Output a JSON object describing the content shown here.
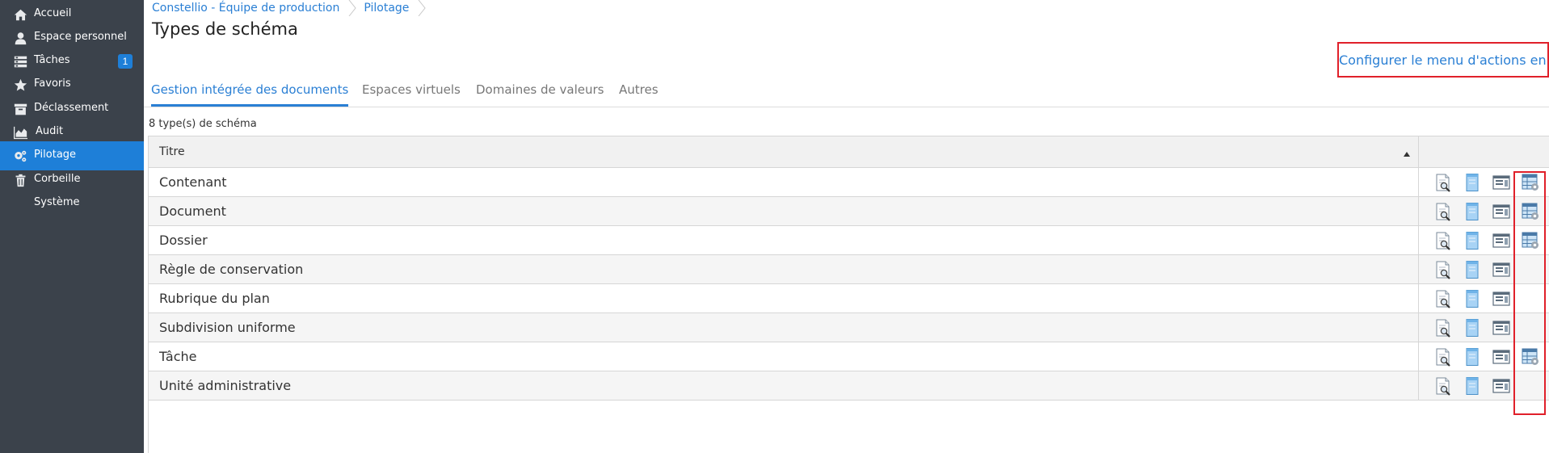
{
  "sidebar": {
    "items": [
      {
        "label": "Accueil",
        "icon": "home-icon",
        "active": false
      },
      {
        "label": "Espace personnel",
        "icon": "user-icon",
        "active": false
      },
      {
        "label": "Tâches",
        "icon": "tasks-icon",
        "active": false,
        "badge": "1"
      },
      {
        "label": "Favoris",
        "icon": "star-icon",
        "active": false
      },
      {
        "label": "Déclassement",
        "icon": "archive-icon",
        "active": false
      },
      {
        "label": "Audit",
        "icon": "chart-area-icon",
        "active": false
      },
      {
        "label": "Pilotage",
        "icon": "gears-icon",
        "active": true
      },
      {
        "label": "Corbeille",
        "icon": "trash-icon",
        "active": false
      },
      {
        "label": "Système",
        "icon": "",
        "active": false
      }
    ]
  },
  "breadcrumb": {
    "items": [
      "Constellio - Équipe de production",
      "Pilotage"
    ]
  },
  "page": {
    "title": "Types de schéma",
    "batch_link": "Configurer le menu d'actions en lot",
    "count_label": "8 type(s) de schéma"
  },
  "tabs": [
    {
      "label": "Gestion intégrée des documents",
      "active": true
    },
    {
      "label": "Espaces virtuels",
      "active": false
    },
    {
      "label": "Domaines de valeurs",
      "active": false
    },
    {
      "label": "Autres",
      "active": false
    }
  ],
  "table": {
    "header_title": "Titre",
    "rows": [
      {
        "title": "Contenant",
        "batch_action": true
      },
      {
        "title": "Document",
        "batch_action": true
      },
      {
        "title": "Dossier",
        "batch_action": true
      },
      {
        "title": "Règle de conservation",
        "batch_action": false
      },
      {
        "title": "Rubrique du plan",
        "batch_action": false
      },
      {
        "title": "Subdivision uniforme",
        "batch_action": false
      },
      {
        "title": "Tâche",
        "batch_action": true
      },
      {
        "title": "Unité administrative",
        "batch_action": false
      }
    ]
  },
  "colors": {
    "sidebar_bg": "#3b424b",
    "active_blue": "#1e7fd8",
    "link_blue": "#2a7fd4",
    "highlight_red": "#e0202a"
  }
}
